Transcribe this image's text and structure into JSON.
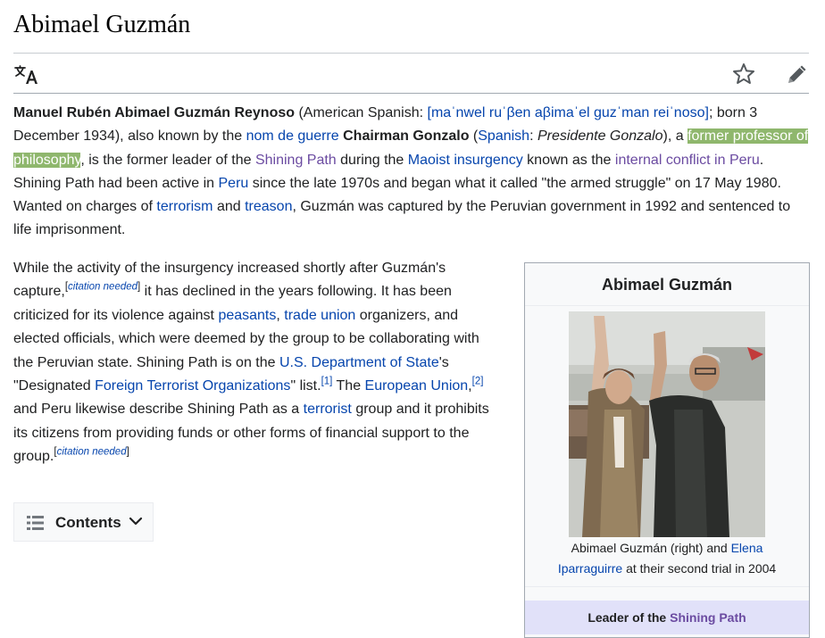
{
  "page": {
    "title": "Abimael Guzmán"
  },
  "toolbar": {
    "language_icon": "translate-icon",
    "watch_icon": "star-icon",
    "edit_icon": "pencil-icon"
  },
  "lead": {
    "name_bold": "Manuel Rubén Abimael Guzmán Reynoso",
    "t1": " (American Spanish: ",
    "ipa": "[maˈnwel ruˈβen aβimaˈel guzˈman reiˈnoso]",
    "t2": "; born 3 December 1934), also known by the ",
    "nom_de_guerre": "nom de guerre",
    "t3": " ",
    "chairman_bold": "Chairman Gonzalo",
    "t4": " (",
    "spanish": "Spanish",
    "t5": ": ",
    "presidente_italic": "Presidente Gonzalo",
    "t6": "), a ",
    "former_professor": "former professor of philosophy",
    "t7": ", is the former leader of the ",
    "shining_path": "Shining Path",
    "t8": " during the ",
    "maoist_insurgency": "Maoist insurgency",
    "t9": " known as the ",
    "internal_conflict": "internal conflict in Peru",
    "t10": ". Shining Path had been active in ",
    "peru": "Peru",
    "t11": " since the late 1970s and began what it called \"the armed struggle\" on 17 May 1980. Wanted on charges of ",
    "terrorism": "terrorism",
    "t12": " and ",
    "treason": "treason",
    "t13": ", Guzmán was captured by the Peruvian government in 1992 and sentenced to life imprisonment."
  },
  "para2": {
    "t1": "While the activity of the insurgency increased shortly after Guzmán's capture,",
    "cn1_open": "[",
    "cn1": "citation needed",
    "cn1_close": "]",
    "t2": " it has declined in the years following. It has been criticized for its violence against ",
    "peasants": "peasants",
    "t3": ", ",
    "trade_union": "trade union",
    "t4": " organizers, and elected officials, which were deemed by the group to be collaborating with the Peruvian state. Shining Path is on the ",
    "us_state": "U.S. Department of State",
    "t5": "'s \"Designated ",
    "fto": "Foreign Terrorist Organizations",
    "t6": "\" list.",
    "ref1": "[1]",
    "t7": " The ",
    "eu": "European Union",
    "t8": ",",
    "ref2": "[2]",
    "t9": " and Peru likewise describe Shining Path as a ",
    "terrorist": "terrorist",
    "t10": " group and it prohibits its citizens from providing funds or other forms of financial support to the group.",
    "cn2_open": "[",
    "cn2": "citation needed",
    "cn2_close": "]"
  },
  "contents": {
    "label": "Contents",
    "list_icon": "list-icon",
    "toggle_icon": "chevron-down-icon"
  },
  "infobox": {
    "title": "Abimael Guzmán",
    "caption_t1": "Abimael Guzmán (right) and ",
    "caption_link": "Elena Iparraguirre",
    "caption_t2": " at their second trial in 2004",
    "header_t1": "Leader of the ",
    "header_link": "Shining Path"
  },
  "colors": {
    "link": "#0645ad",
    "visited_link": "#6b4ba1",
    "highlight": "#8fb76d",
    "infobox_header": "#e1e1f9"
  }
}
